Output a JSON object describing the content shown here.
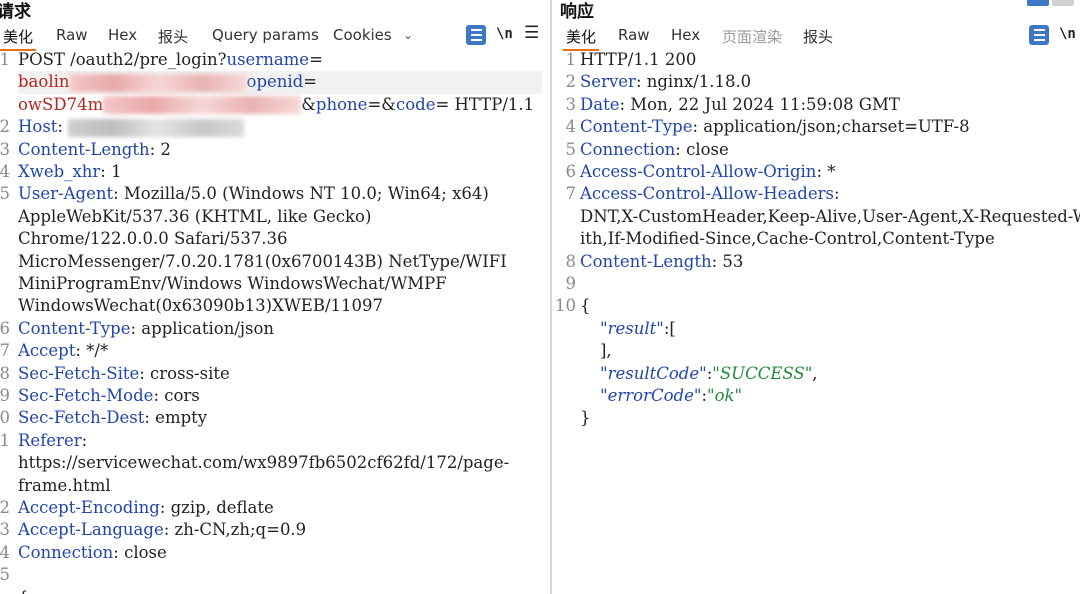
{
  "request": {
    "title": "请求",
    "tabs": [
      "美化",
      "Raw",
      "Hex",
      "报头",
      "Query params",
      "Cookies"
    ],
    "tools": {
      "newline": "\\n"
    },
    "request_line": {
      "method_path": "POST /oauth2/pre_login?",
      "k_username": "username",
      "eq1": "=",
      "username_visible": "baolin",
      "k_openid": "openid",
      "eq2": "=",
      "openid_visible": "owSD74m",
      "amp_phone": "&",
      "k_phone": "phone",
      "eq3": "=&",
      "k_code": "code",
      "eq4": "= HTTP/1.1"
    },
    "headers": [
      {
        "ln": "2",
        "key": "Host",
        "val": ""
      },
      {
        "ln": "3",
        "key": "Content-Length",
        "val": " 2"
      },
      {
        "ln": "4",
        "key": "Xweb_xhr",
        "val": " 1"
      },
      {
        "ln": "5",
        "key": "User-Agent",
        "val": " Mozilla/5.0 (Windows NT 10.0; Win64; x64)"
      }
    ],
    "ua_cont": [
      "AppleWebKit/537.36 (KHTML, like Gecko)",
      "Chrome/122.0.0.0 Safari/537.36",
      "MicroMessenger/7.0.20.1781(0x6700143B) NetType/WIFI",
      "MiniProgramEnv/Windows WindowsWechat/WMPF",
      "WindowsWechat(0x63090b13)XWEB/11097"
    ],
    "headers2": [
      {
        "ln": "6",
        "key": "Content-Type",
        "val": " application/json"
      },
      {
        "ln": "7",
        "key": "Accept",
        "val": " */*"
      },
      {
        "ln": "8",
        "key": "Sec-Fetch-Site",
        "val": " cross-site"
      },
      {
        "ln": "9",
        "key": "Sec-Fetch-Mode",
        "val": " cors"
      },
      {
        "ln": "0",
        "key": "Sec-Fetch-Dest",
        "val": " empty"
      },
      {
        "ln": "1",
        "key": "Referer",
        "val": ""
      }
    ],
    "referer_cont": [
      "https://servicewechat.com/wx9897fb6502cf62fd/172/page-",
      "frame.html"
    ],
    "headers3": [
      {
        "ln": "2",
        "key": "Accept-Encoding",
        "val": " gzip, deflate"
      },
      {
        "ln": "3",
        "key": "Accept-Language",
        "val": " zh-CN,zh;q=0.9"
      },
      {
        "ln": "4",
        "key": "Connection",
        "val": " close"
      }
    ],
    "tail_lines": [
      {
        "ln": "5",
        "text": ""
      },
      {
        "ln": "",
        "text": "{"
      }
    ]
  },
  "response": {
    "title": "响应",
    "tabs": [
      "美化",
      "Raw",
      "Hex",
      "页面渲染",
      "报头"
    ],
    "tools": {
      "newline": "\\n"
    },
    "status_line": "HTTP/1.1 200",
    "headers": [
      {
        "ln": "2",
        "key": "Server",
        "val": " nginx/1.18.0"
      },
      {
        "ln": "3",
        "key": "Date",
        "val": " Mon, 22 Jul 2024 11:59:08 GMT"
      },
      {
        "ln": "4",
        "key": "Content-Type",
        "val": " application/json;charset=UTF-8"
      },
      {
        "ln": "5",
        "key": "Connection",
        "val": " close"
      },
      {
        "ln": "6",
        "key": "Access-Control-Allow-Origin",
        "val": " *"
      },
      {
        "ln": "7",
        "key": "Access-Control-Allow-Headers",
        "val": ""
      }
    ],
    "allow_headers_cont": [
      "DNT,X-CustomHeader,Keep-Alive,User-Agent,X-Requested-W",
      "ith,If-Modified-Since,Cache-Control,Content-Type"
    ],
    "content_length": {
      "ln": "8",
      "key": "Content-Length",
      "val": " 53"
    },
    "body": {
      "open": "{",
      "result_key": "\"result\"",
      "result_open": ":[",
      "result_close": "],",
      "resultCode_key": "\"resultCode\"",
      "resultCode_val": "\"SUCCESS\"",
      "errorCode_key": "\"errorCode\"",
      "errorCode_val": "\"ok\"",
      "close": "}"
    }
  }
}
